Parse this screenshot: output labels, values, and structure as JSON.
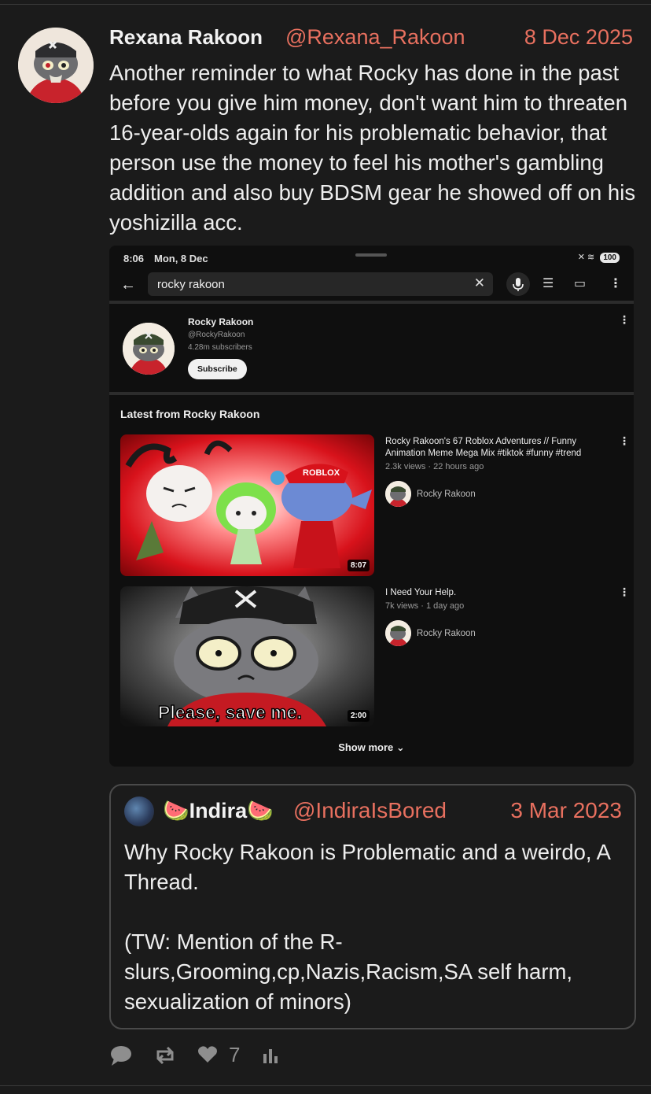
{
  "post": {
    "author_name": "Rexana Rakoon",
    "author_handle": "@Rexana_Rakoon",
    "date": "8 Dec 2025",
    "text": "Another reminder to what Rocky has done in the past before you give him money, don't want him to threaten 16-year-olds again for his problematic behavior, that person use the money to feel his mother's gambling addition and also buy BDSM gear he showed off on his yoshizilla acc."
  },
  "screenshot": {
    "status_time": "8:06",
    "status_date": "Mon, 8 Dec",
    "battery": "100",
    "search_query": "rocky rakoon",
    "channel": {
      "name": "Rocky Rakoon",
      "handle": "@RockyRakoon",
      "subscribers": "4.28m subscribers",
      "subscribe_label": "Subscribe"
    },
    "section_title": "Latest from Rocky Rakoon",
    "videos": [
      {
        "title": "Rocky Rakoon's 67 Roblox Adventures // Funny Animation Meme Mega Mix #tiktok #funny #trend",
        "meta": "2.3k views · 22 hours ago",
        "channel": "Rocky Rakoon",
        "duration": "8:07",
        "thumb_text": "ROBLOX"
      },
      {
        "title": "I Need Your Help.",
        "meta": "7k views · 1 day ago",
        "channel": "Rocky Rakoon",
        "duration": "2:00",
        "thumb_text": "Please, save me."
      }
    ],
    "show_more": "Show more"
  },
  "quote": {
    "author_name": "🍉Indira🍉",
    "author_handle": "@IndiraIsBored",
    "date": "3 Mar 2023",
    "text": "Why Rocky Rakoon is Problematic and a weirdo, A Thread.\n\n(TW: Mention of the R-slurs,Grooming,cp,Nazis,Racism,SA self harm, sexualization of minors)"
  },
  "actions": {
    "likes": "7",
    "icons": [
      "reply-icon",
      "repost-icon",
      "heart-icon",
      "stats-icon"
    ]
  },
  "colors": {
    "background": "#1b1b1b",
    "accent": "#e8705f",
    "text": "#eeeeee",
    "muted": "#8e8e8e"
  }
}
